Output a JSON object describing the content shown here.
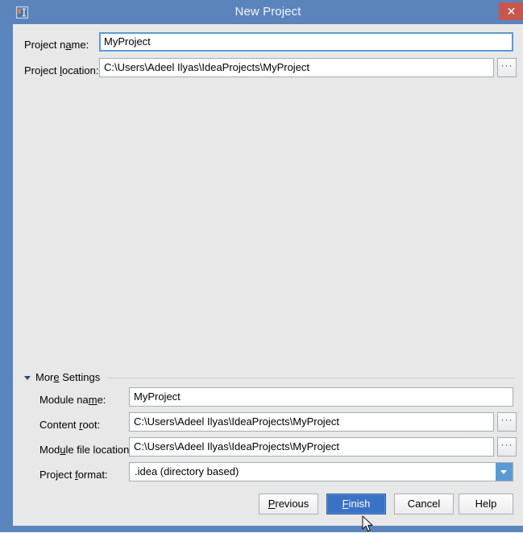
{
  "window": {
    "title": "New Project",
    "app_icon": "intellij-idea-icon",
    "close_label": "✕",
    "accent_color": "#5b84bd",
    "close_color": "#c7564f",
    "background_color": "#e8e8e8"
  },
  "main_form": {
    "fields": [
      {
        "label_before": "Project n",
        "mnemonic": "a",
        "label_after": "me:",
        "value": "MyProject",
        "focused": true,
        "has_browse": false
      },
      {
        "label_before": "Project ",
        "mnemonic": "l",
        "label_after": "ocation:",
        "value": "C:\\Users\\Adeel Ilyas\\IdeaProjects\\MyProject",
        "focused": false,
        "has_browse": true,
        "browse_label": "···"
      }
    ]
  },
  "more_settings": {
    "label_before": "Mor",
    "mnemonic": "e",
    "label_after": " Settings",
    "expanded": true,
    "fields": [
      {
        "label_before": "Module na",
        "mnemonic": "m",
        "label_after": "e:",
        "value": "MyProject",
        "has_browse": false
      },
      {
        "label_before": "Content ",
        "mnemonic": "r",
        "label_after": "oot:",
        "value": "C:\\Users\\Adeel Ilyas\\IdeaProjects\\MyProject",
        "has_browse": true,
        "browse_label": "···"
      },
      {
        "label_before": "Mod",
        "mnemonic": "u",
        "label_after": "le file location:",
        "value": "C:\\Users\\Adeel Ilyas\\IdeaProjects\\MyProject",
        "has_browse": true,
        "browse_label": "···"
      }
    ],
    "project_format": {
      "label_before": "Project ",
      "mnemonic": "f",
      "label_after": "ormat:",
      "value": ".idea (directory based)"
    }
  },
  "buttons": [
    {
      "label_before": "",
      "mnemonic": "P",
      "label_after": "revious",
      "default": false
    },
    {
      "label_before": "",
      "mnemonic": "F",
      "label_after": "inish",
      "default": true
    },
    {
      "label_before": "Cancel",
      "mnemonic": "",
      "label_after": "",
      "default": false
    },
    {
      "label_before": "Help",
      "mnemonic": "",
      "label_after": "",
      "default": false
    }
  ]
}
